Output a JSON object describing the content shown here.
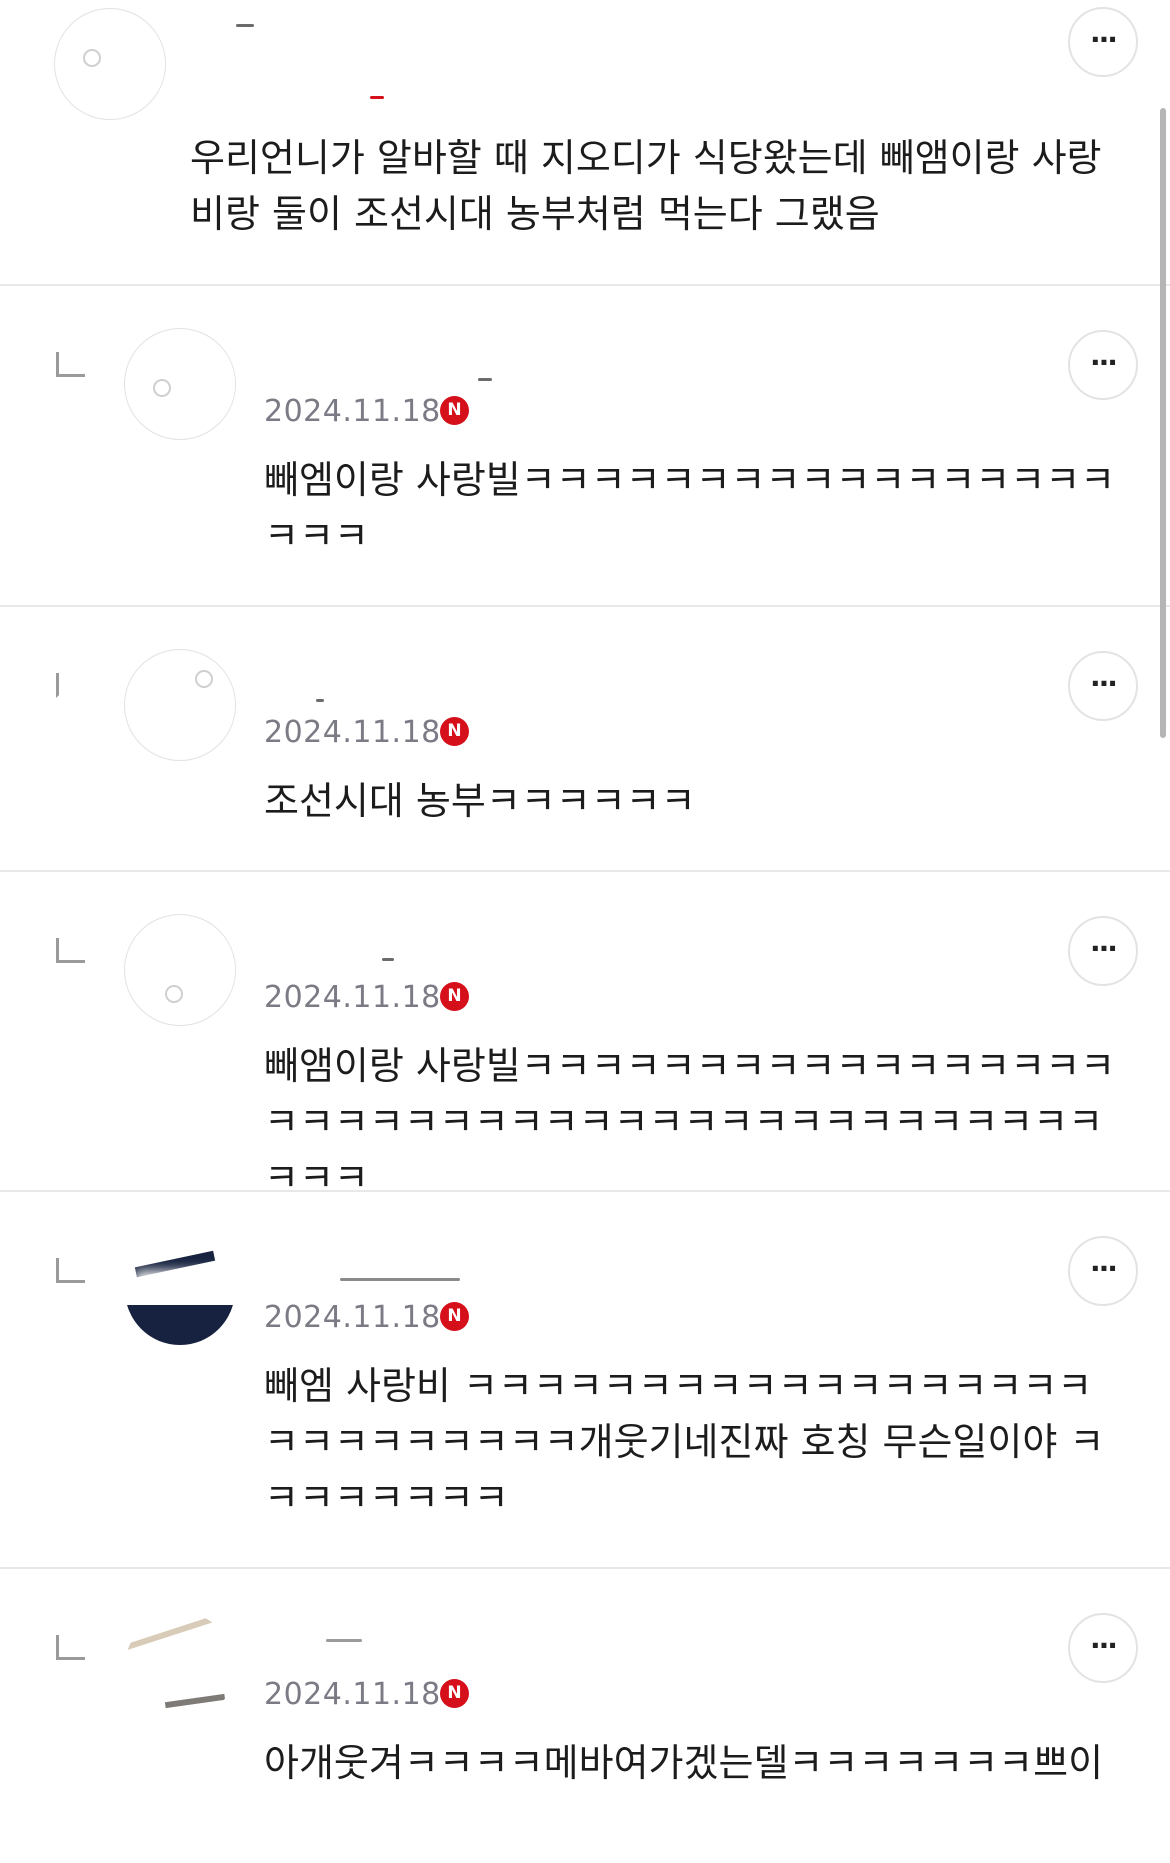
{
  "comments": [
    {
      "is_reply": false,
      "username": "",
      "date": "",
      "badge": "",
      "more_label": "···",
      "text": "우리언니가 알바할 때 지오디가 식당왔는데 빼앰이랑 사랑비랑 둘이 조선시대 농부처럼 먹는다 그랬음"
    },
    {
      "is_reply": true,
      "username": "",
      "date": "2024.11.18",
      "badge": "N",
      "more_label": "···",
      "text": "빼엠이랑 사랑빌ㅋㅋㅋㅋㅋㅋㅋㅋㅋㅋㅋㅋㅋㅋㅋㅋㅋㅋㅋㅋ"
    },
    {
      "is_reply": true,
      "username": "",
      "date": "2024.11.18",
      "badge": "N",
      "more_label": "···",
      "text": "조선시대 농부ㅋㅋㅋㅋㅋㅋ"
    },
    {
      "is_reply": true,
      "username": "",
      "date": "2024.11.18",
      "badge": "N",
      "more_label": "···",
      "text": "빼앰이랑 사랑빌ㅋㅋㅋㅋㅋㅋㅋㅋㅋㅋㅋㅋㅋㅋㅋㅋㅋㅋㅋㅋㅋㅋㅋㅋㅋㅋㅋㅋㅋㅋㅋㅋㅋㅋㅋㅋㅋㅋㅋㅋㅋㅋㅋㅋ"
    },
    {
      "is_reply": true,
      "username": "",
      "date": "2024.11.18",
      "badge": "N",
      "more_label": "···",
      "text": "빼엠 사랑비 ㅋㅋㅋㅋㅋㅋㅋㅋㅋㅋㅋㅋㅋㅋㅋㅋㅋㅋㅋㅋㅋㅋㅋㅋㅋㅋㅋ개웃기네진짜 호칭 무슨일이야 ㅋㅋㅋㅋㅋㅋㅋㅋ"
    },
    {
      "is_reply": true,
      "username": "",
      "date": "2024.11.18",
      "badge": "N",
      "more_label": "···",
      "text": "아개웃겨ㅋㅋㅋㅋ메바여가겠는델ㅋㅋㅋㅋㅋㅋㅋ쁘이"
    }
  ]
}
